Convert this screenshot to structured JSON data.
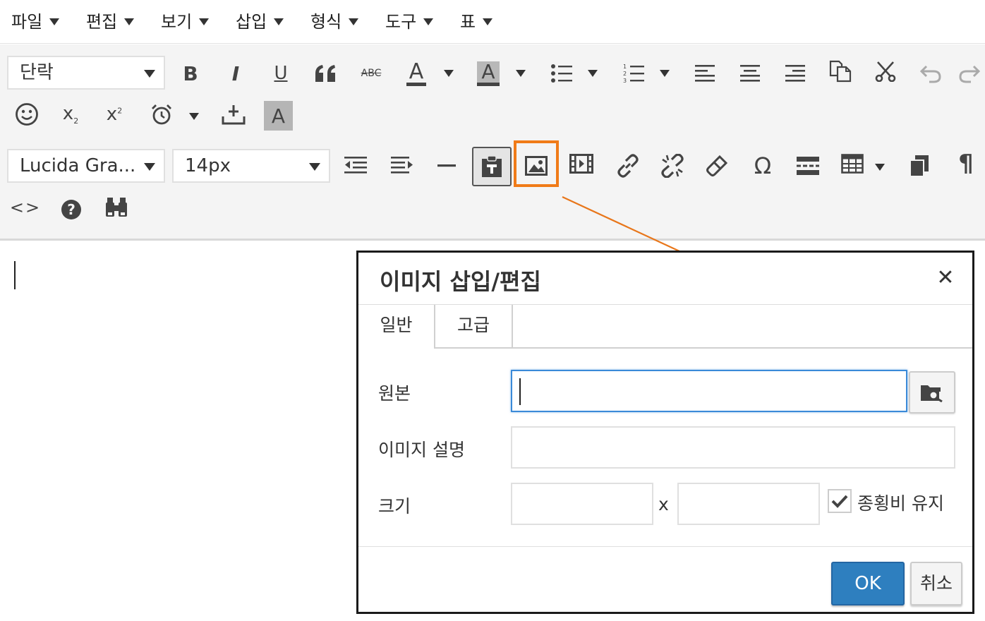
{
  "menubar": {
    "items": [
      {
        "label": "파일"
      },
      {
        "label": "편집"
      },
      {
        "label": "보기"
      },
      {
        "label": "삽입"
      },
      {
        "label": "형식"
      },
      {
        "label": "도구"
      },
      {
        "label": "표"
      }
    ]
  },
  "toolbar": {
    "block_format": "단락",
    "font_family": "Lucida Gra...",
    "font_size": "14px",
    "bold_glyph": "B",
    "italic_glyph": "I",
    "underline_glyph": "U",
    "strike_glyph": "ABC",
    "text_color_glyph": "A",
    "bg_color_glyph": "A",
    "highlight_glyph": "A",
    "omega_glyph": "Ω",
    "pilcrow_glyph": "¶",
    "code_glyph": "<>",
    "help_glyph": "?",
    "sub_base": "x",
    "sub_index": "2",
    "sup_base": "x",
    "sup_index": "2",
    "icons": [
      "bold-icon",
      "italic-icon",
      "underline-icon",
      "blockquote-icon",
      "strikethrough-icon",
      "text-color-icon",
      "background-color-icon",
      "bullet-list-icon",
      "numbered-list-icon",
      "align-left-icon",
      "align-center-icon",
      "align-right-icon",
      "copy-icon",
      "cut-icon",
      "undo-icon",
      "redo-icon",
      "emoji-icon",
      "subscript-icon",
      "superscript-icon",
      "alarm-icon",
      "insert-icon",
      "highlight-icon",
      "outdent-icon",
      "indent-icon",
      "horizontal-rule-icon",
      "paste-icon",
      "image-icon",
      "video-icon",
      "link-icon",
      "unlink-icon",
      "eraser-icon",
      "omega-icon",
      "page-break-icon",
      "table-icon",
      "copy-format-icon",
      "pilcrow-icon",
      "code-icon",
      "help-icon",
      "find-icon"
    ]
  },
  "colors": {
    "highlight_box": "#f07b18",
    "arrow": "#e8761a",
    "ok_button": "#2e7fbf",
    "focus_border": "#3a8ad8"
  },
  "dialog": {
    "title": "이미지 삽입/편집",
    "close_glyph": "✕",
    "tabs": [
      {
        "label": "일반",
        "active": true
      },
      {
        "label": "고급",
        "active": false
      }
    ],
    "fields": {
      "source_label": "원본",
      "source_value": "",
      "description_label": "이미지 설명",
      "description_value": "",
      "size_label": "크기",
      "width_value": "",
      "size_separator": "x",
      "height_value": "",
      "constrain_label": "종횡비 유지",
      "constrain_checked": true
    },
    "ok_label": "OK",
    "cancel_label": "취소"
  }
}
